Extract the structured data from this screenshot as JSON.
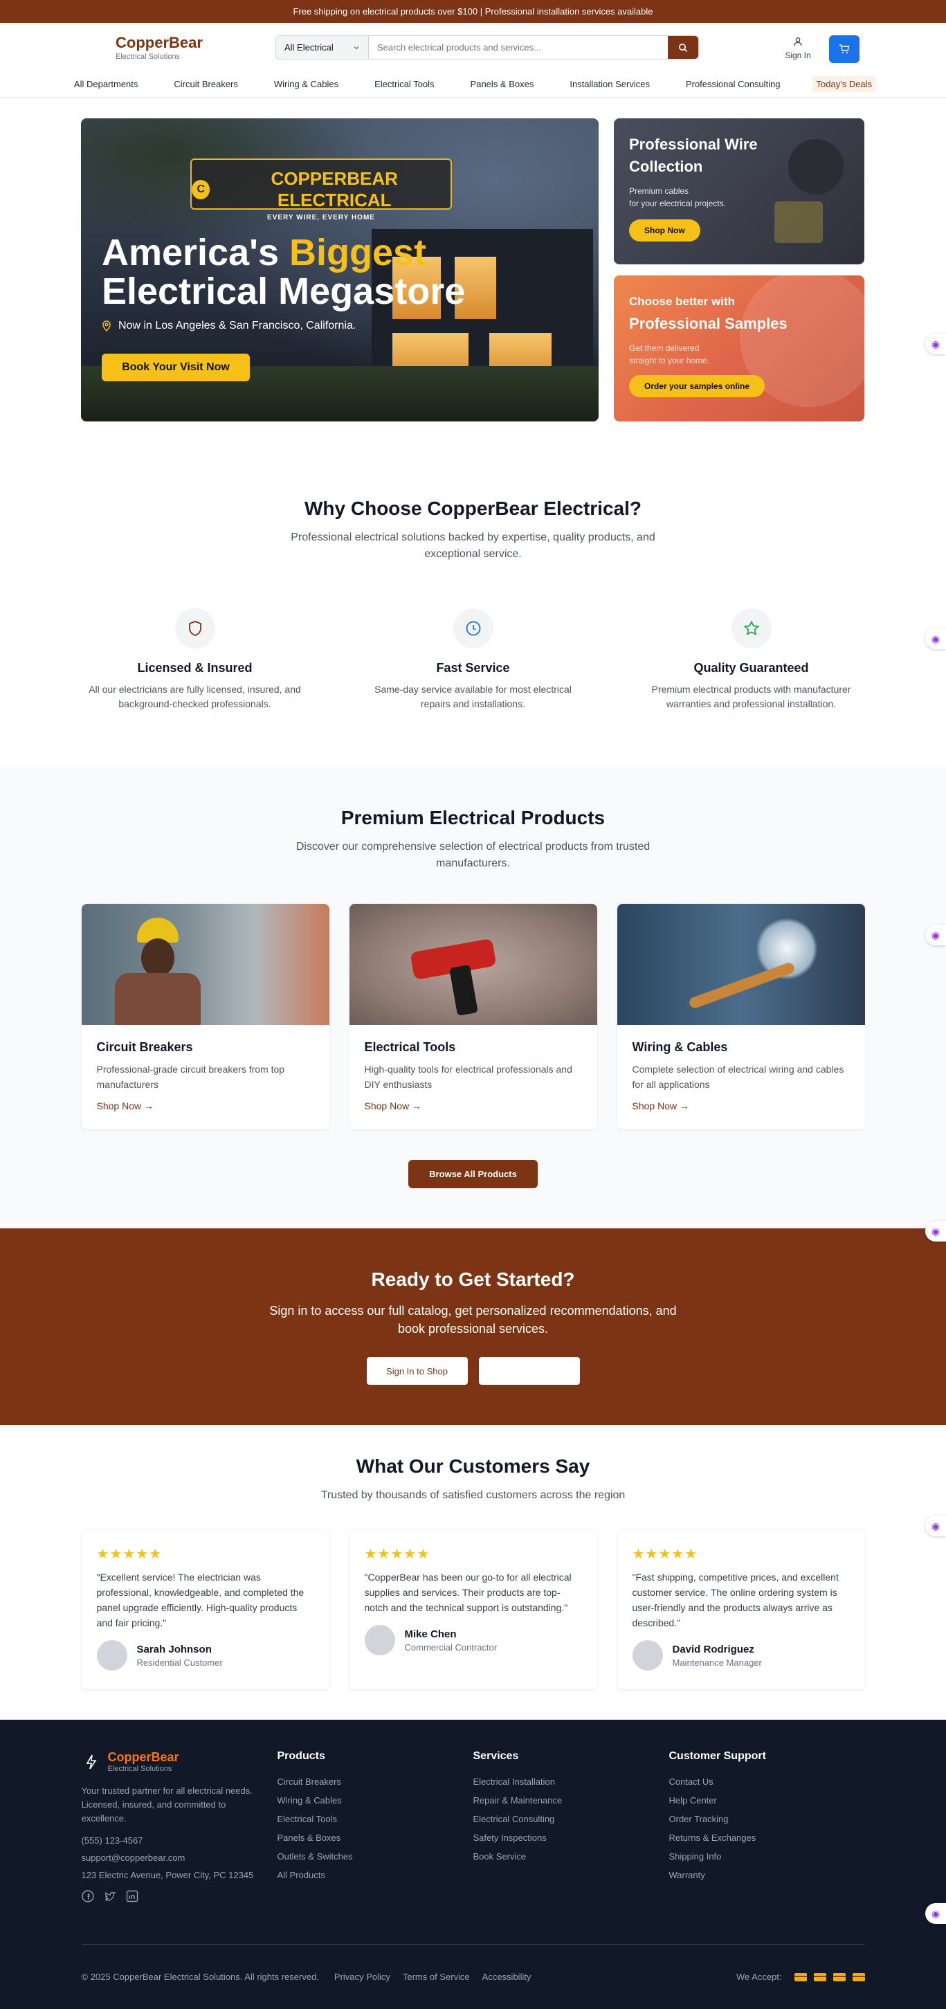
{
  "topbar": {
    "text": "Free shipping on electrical products over $100 | Professional installation services available"
  },
  "header": {
    "logo_name": "CopperBear",
    "logo_sub": "Electrical Solutions",
    "search_category": "All Electrical",
    "search_placeholder": "Search electrical products and services...",
    "signin_label": "Sign In"
  },
  "nav": {
    "items": [
      "All Departments",
      "Circuit Breakers",
      "Wiring & Cables",
      "Electrical Tools",
      "Panels & Boxes",
      "Installation Services",
      "Professional Consulting"
    ],
    "deals": "Today's Deals"
  },
  "hero": {
    "badge_letter": "C",
    "badge_title": "COPPERBEAR ELECTRICAL",
    "badge_sub": "EVERY WIRE, EVERY HOME",
    "title_1": "America's ",
    "title_highlight": "Biggest",
    "title_2": "Electrical Megastore",
    "location": "Now in Los Angeles & San Francisco, California.",
    "button": "Book Your Visit Now"
  },
  "promos": [
    {
      "title": "Professional Wire Collection",
      "desc_1": "Premium cables",
      "desc_2": "for your electrical projects.",
      "button": "Shop Now"
    },
    {
      "title_1": "Choose better with",
      "title_2": "Professional Samples",
      "desc_1": "Get them delivered",
      "desc_2": "straight to your home.",
      "button": "Order your samples online"
    }
  ],
  "why": {
    "title": "Why Choose CopperBear Electrical?",
    "subtitle": "Professional electrical solutions backed by expertise, quality products, and exceptional service.",
    "features": [
      {
        "icon": "shield-icon",
        "title": "Licensed & Insured",
        "desc": "All our electricians are fully licensed, insured, and background-checked professionals."
      },
      {
        "icon": "clock-icon",
        "title": "Fast Service",
        "desc": "Same-day service available for most electrical repairs and installations."
      },
      {
        "icon": "star-icon",
        "title": "Quality Guaranteed",
        "desc": "Premium electrical products with manufacturer warranties and professional installation."
      }
    ]
  },
  "products": {
    "title": "Premium Electrical Products",
    "subtitle": "Discover our comprehensive selection of electrical products from trusted manufacturers.",
    "cards": [
      {
        "title": "Circuit Breakers",
        "desc": "Professional-grade circuit breakers from top manufacturers",
        "link": "Shop Now →"
      },
      {
        "title": "Electrical Tools",
        "desc": "High-quality tools for electrical professionals and DIY enthusiasts",
        "link": "Shop Now →"
      },
      {
        "title": "Wiring & Cables",
        "desc": "Complete selection of electrical wiring and cables for all applications",
        "link": "Shop Now →"
      }
    ],
    "browse": "Browse All Products"
  },
  "cta": {
    "title": "Ready to Get Started?",
    "desc": "Sign in to access our full catalog, get personalized recommendations, and book professional services.",
    "button_1": "Sign In to Shop",
    "button_2": ""
  },
  "testimonials": {
    "title": "What Our Customers Say",
    "subtitle": "Trusted by thousands of satisfied customers across the region",
    "items": [
      {
        "stars": "★★★★★",
        "quote": "\"Excellent service! The electrician was professional, knowledgeable, and completed the panel upgrade efficiently. High-quality products and fair pricing.\"",
        "name": "Sarah Johnson",
        "role": "Residential Customer"
      },
      {
        "stars": "★★★★★",
        "quote": "\"CopperBear has been our go-to for all electrical supplies and services. Their products are top-notch and the technical support is outstanding.\"",
        "name": "Mike Chen",
        "role": "Commercial Contractor"
      },
      {
        "stars": "★★★★★",
        "quote": "\"Fast shipping, competitive prices, and excellent customer service. The online ordering system is user-friendly and the products always arrive as described.\"",
        "name": "David Rodriguez",
        "role": "Maintenance Manager"
      }
    ]
  },
  "footer": {
    "logo_name": "CopperBear",
    "logo_sub": "Electrical Solutions",
    "desc": "Your trusted partner for all electrical needs. Licensed, insured, and committed to excellence.",
    "phone": "(555) 123-4567",
    "email": "support@copperbear.com",
    "address": "123 Electric Avenue, Power City, PC 12345",
    "cols": [
      {
        "title": "Products",
        "items": [
          "Circuit Breakers",
          "Wiring & Cables",
          "Electrical Tools",
          "Panels & Boxes",
          "Outlets & Switches",
          "All Products"
        ]
      },
      {
        "title": "Services",
        "items": [
          "Electrical Installation",
          "Repair & Maintenance",
          "Electrical Consulting",
          "Safety Inspections",
          "Book Service"
        ]
      },
      {
        "title": "Customer Support",
        "items": [
          "Contact Us",
          "Help Center",
          "Order Tracking",
          "Returns & Exchanges",
          "Shipping Info",
          "Warranty"
        ]
      }
    ],
    "copyright": "© 2025 CopperBear Electrical Solutions. All rights reserved.",
    "legal": [
      "Privacy Policy",
      "Terms of Service",
      "Accessibility"
    ],
    "accept": "We Accept:"
  },
  "colors": {
    "brand": "#7c3414",
    "accent": "#f5c017",
    "cart": "#1a73e8"
  }
}
